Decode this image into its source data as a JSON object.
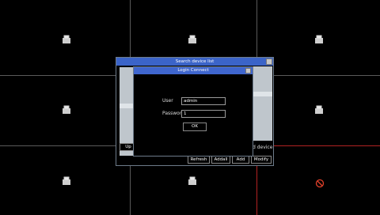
{
  "search_window": {
    "title": "Search device list",
    "up_label": "Up",
    "add_device_label": "d device",
    "buttons": {
      "refresh": "Refresh",
      "addall": "Addall",
      "add": "Add",
      "modify": "Modify"
    }
  },
  "login_dialog": {
    "title": "Login Connect",
    "user_label": "User",
    "user_value": "admin",
    "password_label": "Password",
    "password_value": "1",
    "ok_label": "OK"
  },
  "colors": {
    "title_bar": "#3b64c8",
    "grid_line": "#5a5a5a",
    "alert_line": "#b32222",
    "list_bg": "#bfc6cc"
  },
  "icons": {
    "camera_cells": "camera-icon",
    "no_entry_cell": "no-entry-icon"
  }
}
